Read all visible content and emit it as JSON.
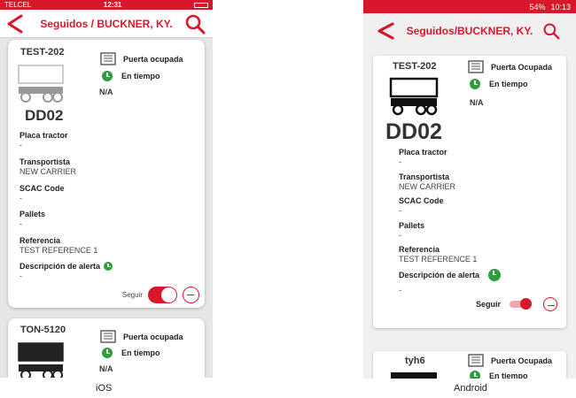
{
  "ios": {
    "status": {
      "carrier": "TELCEL",
      "time": "12:31"
    },
    "title": "Seguidos / BUCKNER, KY.",
    "card1": {
      "unit_id": "TEST-202",
      "door_status": "Puerta ocupada",
      "time_status": "En tiempo",
      "na": "N/A",
      "dock": "DD02",
      "fields": [
        {
          "label": "Placa tractor",
          "value": "-"
        },
        {
          "label": "Transportista",
          "value": "NEW CARRIER"
        },
        {
          "label": "SCAC Code",
          "value": "-"
        },
        {
          "label": "Pallets",
          "value": "-"
        },
        {
          "label": "Referencia",
          "value": "TEST REFERENCE 1"
        },
        {
          "label": "Descripción de alerta",
          "value": "-"
        }
      ],
      "follow_label": "Seguir",
      "follow_on": true
    },
    "card2": {
      "unit_id": "TON-5120",
      "door_status": "Puerta ocupada",
      "time_status": "En tiempo",
      "na": "N/A"
    },
    "caption": "iOS"
  },
  "android": {
    "status": {
      "battery": "54%",
      "time": "10:13"
    },
    "title": "Seguidos/BUCKNER, KY.",
    "card1": {
      "unit_id": "TEST-202",
      "door_status": "Puerta Ocupada",
      "time_status": "En tiempo",
      "na": "N/A",
      "dock": "DD02",
      "fields": [
        {
          "label": "Placa tractor",
          "value": "-"
        },
        {
          "label": "Transportista",
          "value": "NEW CARRIER"
        },
        {
          "label": "SCAC Code",
          "value": "-"
        },
        {
          "label": "Pallets",
          "value": "-"
        },
        {
          "label": "Referencia",
          "value": "TEST REFERENCE 1"
        },
        {
          "label": "Descripción de alerta",
          "value": "-"
        }
      ],
      "follow_label": "Seguir",
      "follow_on": true
    },
    "card2": {
      "unit_id": "tyh6",
      "door_status": "Puerta Ocupada",
      "time_status": "En tiempo"
    },
    "caption": "Android"
  },
  "colors": {
    "brand_red": "#d7182a",
    "on_time_green": "#2e9e3a"
  },
  "icons": [
    "back-chevron-icon",
    "search-icon",
    "door-icon",
    "clock-icon",
    "trailer-icon",
    "minus-circle-icon"
  ]
}
